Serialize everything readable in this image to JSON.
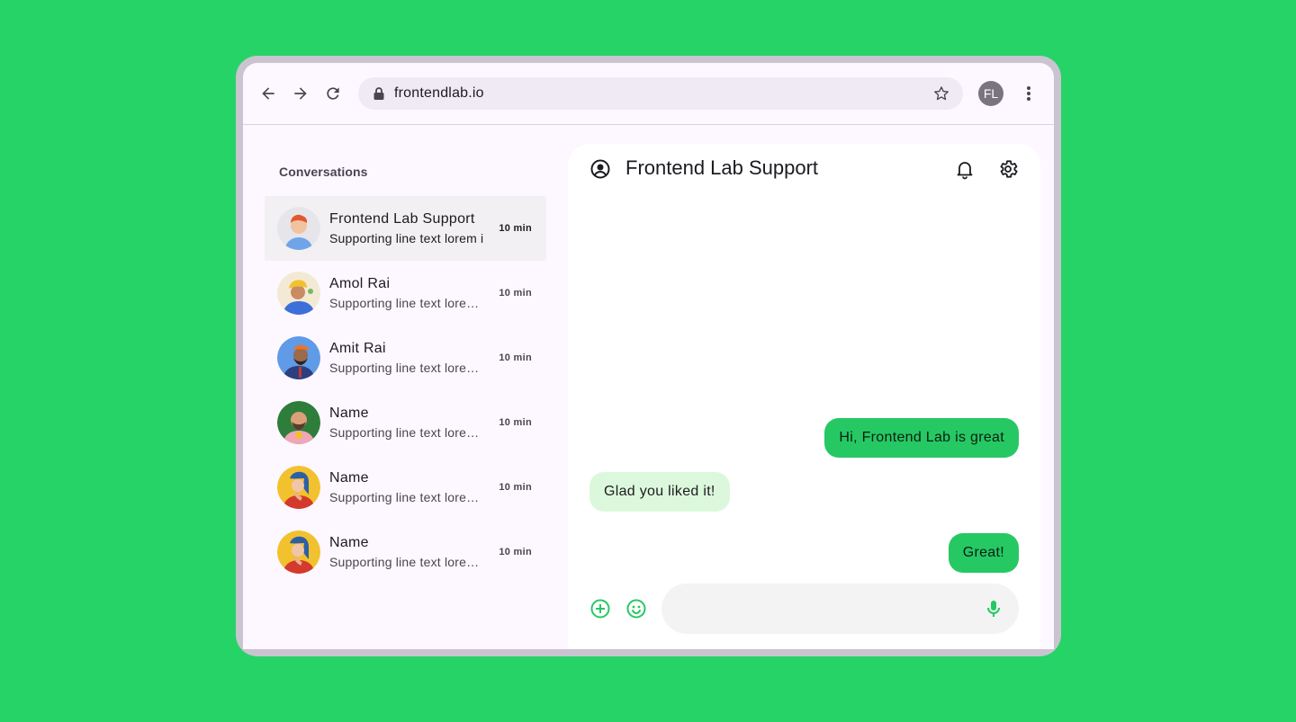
{
  "browser": {
    "url": "frontendlab.io",
    "profile_initials": "FL",
    "icons": [
      "back-arrow-icon",
      "forward-arrow-icon",
      "reload-icon",
      "lock-icon",
      "star-icon",
      "more-vert-icon"
    ]
  },
  "sidebar": {
    "title": "Conversations",
    "items": [
      {
        "name": "Frontend Lab Support",
        "supporting": "Supporting line text lorem ipsum",
        "time": "10 min",
        "selected": true
      },
      {
        "name": "Amol Rai",
        "supporting": "Supporting line text lorem ipsum",
        "time": "10 min"
      },
      {
        "name": "Amit Rai",
        "supporting": "Supporting line text lorem ipsum",
        "time": "10 min"
      },
      {
        "name": "Name",
        "supporting": "Supporting line text lorem ipsum",
        "time": "10 min"
      },
      {
        "name": "Name",
        "supporting": "Supporting line text lorem ipsum",
        "time": "10 min"
      },
      {
        "name": "Name",
        "supporting": "Supporting line text lorem ipsum",
        "time": "10 min"
      }
    ]
  },
  "chat": {
    "title": "Frontend Lab Support",
    "messages": [
      {
        "direction": "outgoing",
        "text": "Hi, Frontend Lab is great"
      },
      {
        "direction": "incoming",
        "text": "Glad you liked it!"
      },
      {
        "direction": "outgoing",
        "text": "Great!"
      }
    ],
    "composer": {
      "value": "",
      "placeholder": ""
    }
  },
  "colors": {
    "background": "#26d366",
    "frame": "#cac4d0",
    "accent": "#26c864",
    "incoming_bubble": "#dcf8dc",
    "selected_row": "#f3f0f4"
  }
}
